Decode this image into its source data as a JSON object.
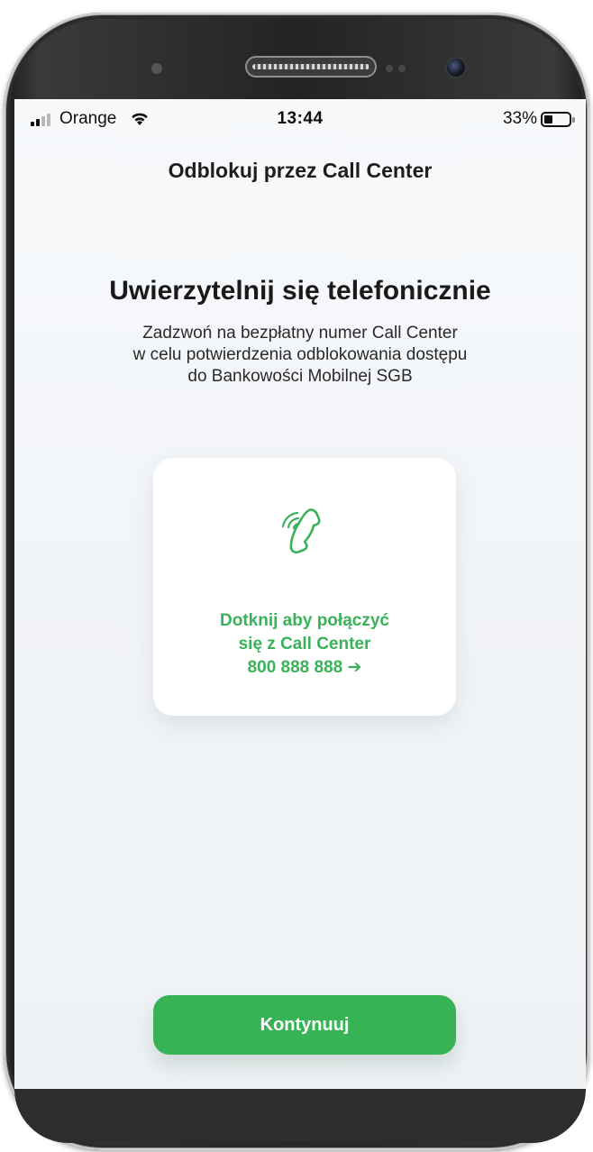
{
  "status_bar": {
    "carrier": "Orange",
    "time": "13:44",
    "battery_percent": "33%",
    "signal_icon": "signal-bars-icon",
    "wifi_icon": "wifi-icon",
    "battery_icon": "battery-icon"
  },
  "header": {
    "title": "Odblokuj przez Call Center"
  },
  "main": {
    "headline": "Uwierzytelnij się telefonicznie",
    "description_lines": [
      "Zadzwoń na bezpłatny numer Call Center",
      "w celu potwierdzenia odblokowania dostępu",
      "do Bankowości Mobilnej SGB"
    ]
  },
  "call_card": {
    "icon": "phone-ringing-icon",
    "lines": [
      "Dotknij aby połączyć",
      "się z Call Center",
      "800 888 888 ➔"
    ]
  },
  "footer": {
    "continue_label": "Kontynuuj"
  },
  "colors": {
    "accent_green": "#37b356",
    "text_green": "#3ab25a",
    "background": "#f4f6f8"
  }
}
